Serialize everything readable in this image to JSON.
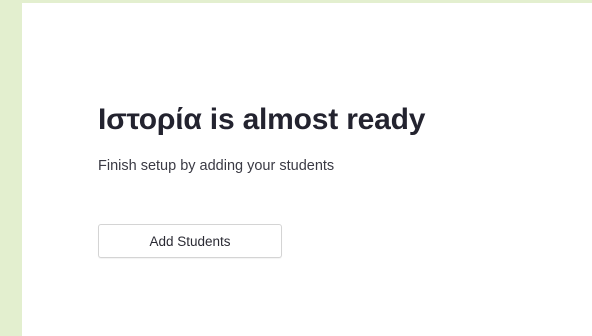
{
  "setup": {
    "title": "Ιστορία is almost ready",
    "subtitle": "Finish setup by adding your students",
    "add_students_label": "Add Students"
  }
}
